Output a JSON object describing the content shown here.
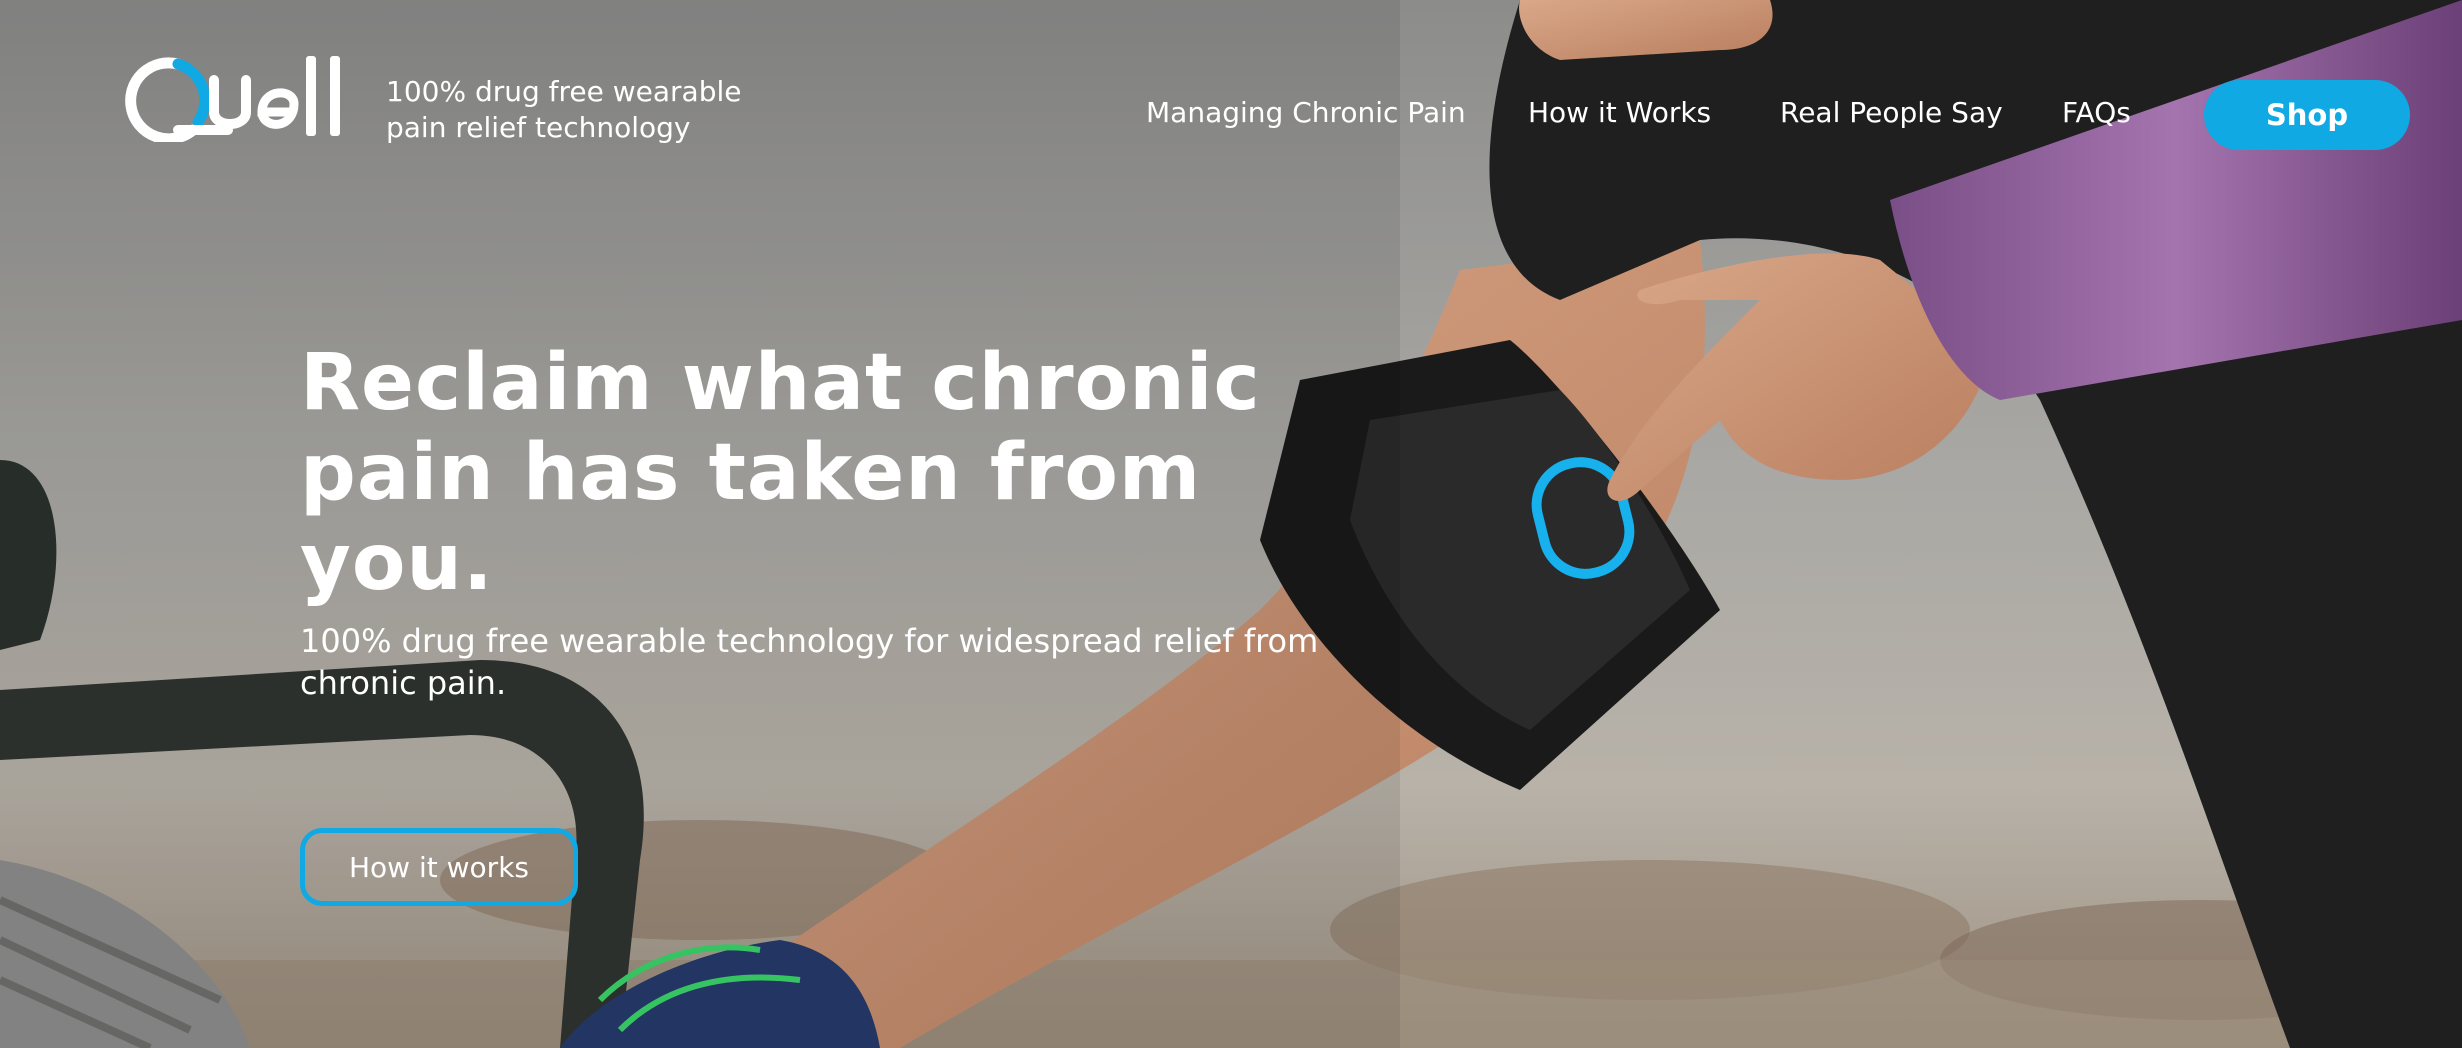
{
  "brand": {
    "name": "Quell",
    "tagline_line1": "100% drug free wearable",
    "tagline_line2": "pain relief technology",
    "accent_color": "#10a9e3"
  },
  "nav": {
    "items": [
      {
        "label": "Managing Chronic Pain"
      },
      {
        "label": "How it Works"
      },
      {
        "label": "Real People Say"
      },
      {
        "label": "FAQs"
      }
    ],
    "shop_label": "Shop"
  },
  "hero": {
    "headline_line1": "Reclaim what chronic",
    "headline_line2": "pain has taken from you.",
    "subheading": "100% drug free wearable technology for widespread relief from chronic pain.",
    "cta_label": "How it works",
    "device_label": "Quell"
  }
}
